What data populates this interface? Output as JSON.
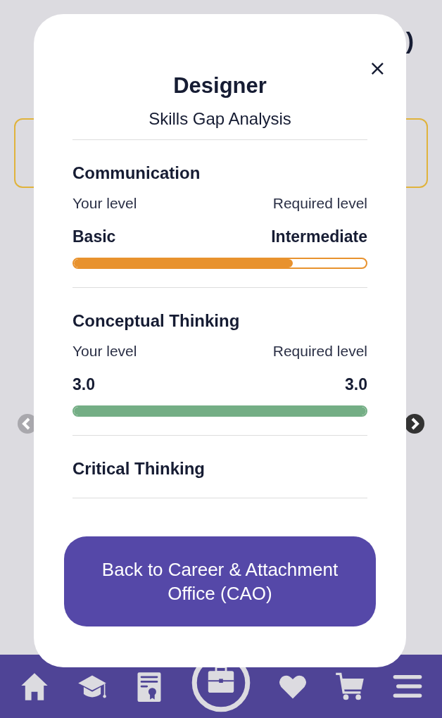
{
  "background": {
    "title_end": ")"
  },
  "modal": {
    "close": "×",
    "title": "Designer",
    "subtitle": "Skills Gap Analysis",
    "skills": [
      {
        "name": "Communication",
        "your_label": "Your level",
        "required_label": "Required level",
        "your_value": "Basic",
        "required_value": "Intermediate",
        "level": 0.75,
        "color": "#e8922e"
      },
      {
        "name": "Conceptual Thinking",
        "your_label": "Your level",
        "required_label": "Required level",
        "your_value": "3.0",
        "required_value": "3.0",
        "level": 1,
        "color": "#74ae85"
      },
      {
        "name": "Critical Thinking"
      }
    ],
    "button": "Back to Career & Attachment Office (CAO)"
  },
  "nav": [
    {
      "kind": "home",
      "selected": false
    },
    {
      "kind": "education",
      "selected": false
    },
    {
      "kind": "certificate",
      "selected": false
    },
    {
      "kind": "career",
      "selected": true
    },
    {
      "kind": "favorites",
      "selected": false
    },
    {
      "kind": "cart",
      "selected": false
    },
    {
      "kind": "menu",
      "selected": false
    }
  ]
}
